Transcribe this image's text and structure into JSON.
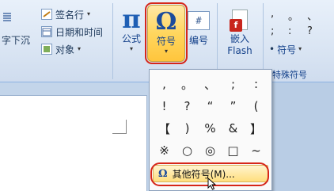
{
  "ribbon": {
    "text_group": {
      "partial_button_label": "字下沉",
      "signature_line_label": "签名行",
      "datetime_label": "日期和时间",
      "object_label": "对象"
    },
    "formula_label": "公式",
    "symbol_label": "符号",
    "number_label": "编号",
    "number_icon_text": "#",
    "embed_flash_label_line1": "嵌入",
    "embed_flash_label_line2": "Flash",
    "special_group": {
      "symbol_button_label": "符号",
      "group_label": "特殊符号",
      "quick_symbols": [
        ",",
        "。",
        "、",
        ";",
        ":",
        "?",
        "•"
      ]
    }
  },
  "symbols_dropdown": {
    "symbols": [
      ",",
      "。",
      "、",
      ";",
      ":",
      "!",
      "?",
      "“",
      "”",
      "(",
      "【",
      ")",
      "%",
      "&",
      "】",
      "※",
      "○",
      "◎",
      "□",
      "~"
    ],
    "more_symbols_label": "其他符号(M)..."
  },
  "icons": {
    "formula": "pi-icon",
    "symbol": "omega-icon",
    "number": "number-icon",
    "flash": "flash-icon"
  },
  "colors": {
    "highlight_ring": "#d6261a",
    "hover_gradient_top": "#ffe8a6",
    "hover_gradient_bottom": "#ffc53d"
  }
}
